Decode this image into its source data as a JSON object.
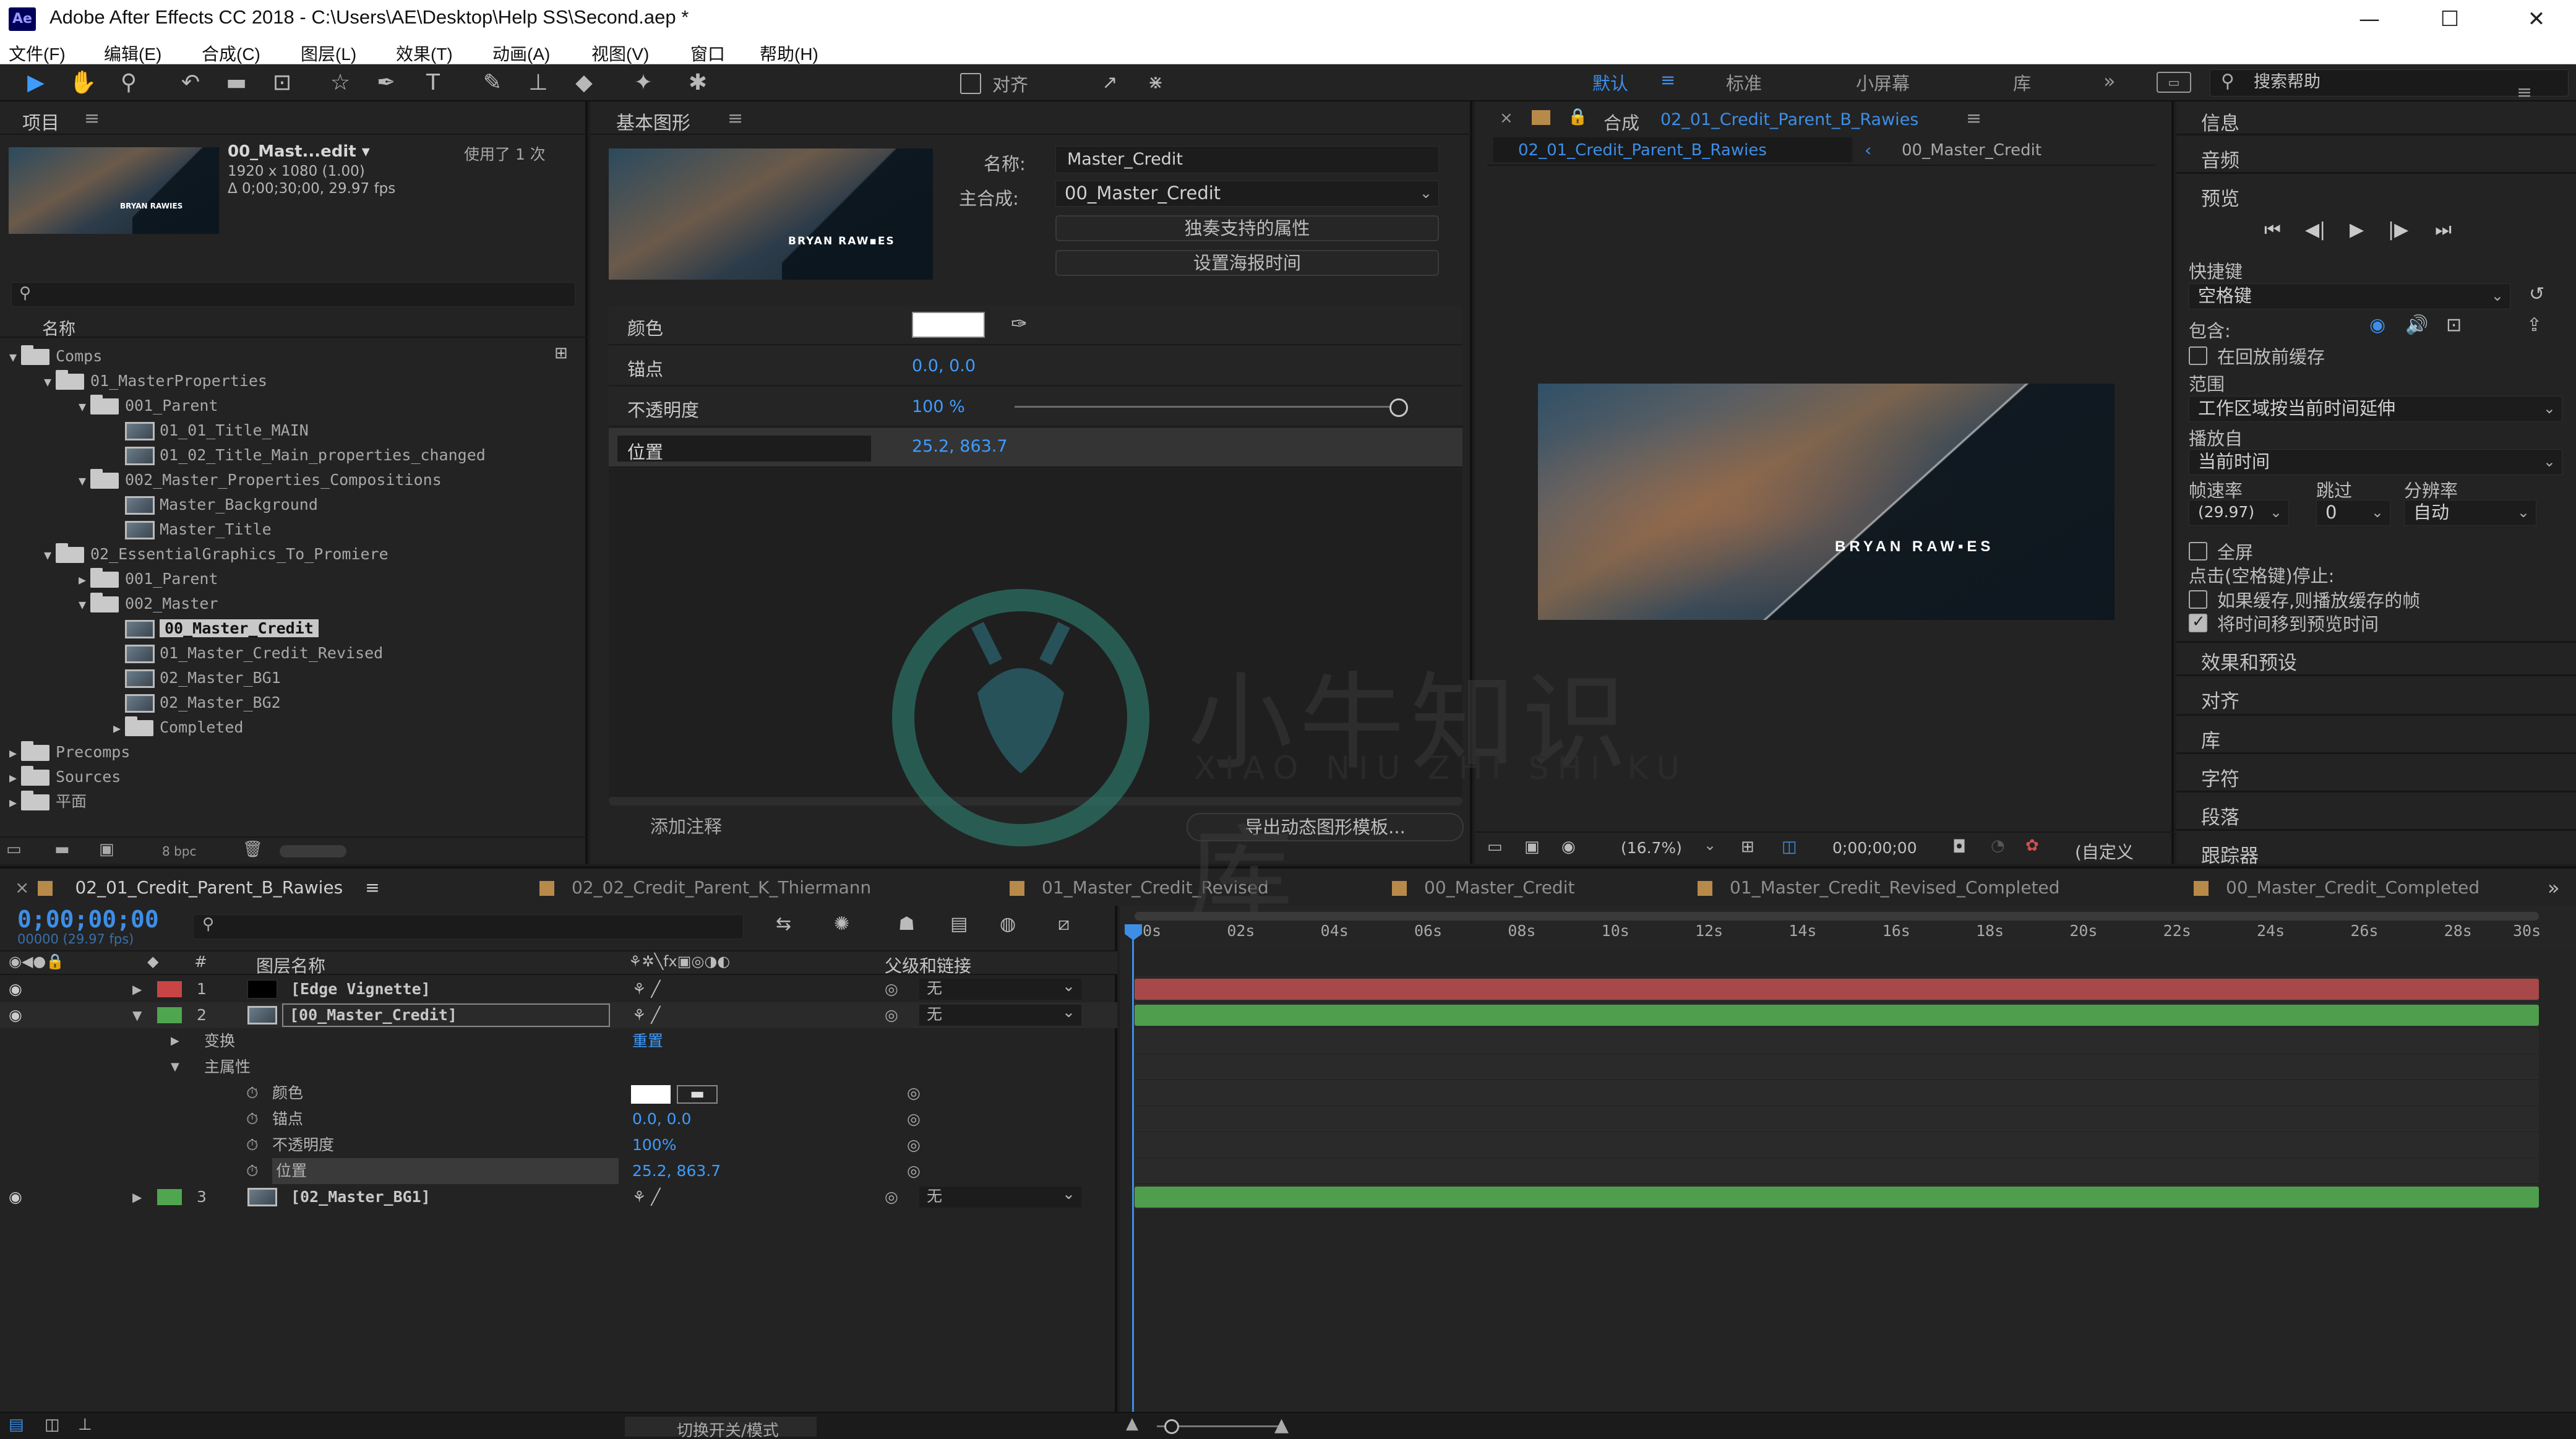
{
  "window": {
    "app_badge": "Ae",
    "title": "Adobe After Effects CC 2018 - C:\\Users\\AE\\Desktop\\Help SS\\Second.aep *",
    "min_glyph": "—",
    "max_glyph": "☐",
    "close_glyph": "✕"
  },
  "menu": [
    "文件(F)",
    "编辑(E)",
    "合成(C)",
    "图层(L)",
    "效果(T)",
    "动画(A)",
    "视图(V)",
    "窗口",
    "帮助(H)"
  ],
  "toolbar": {
    "align_label": "对齐",
    "workspaces": [
      "默认",
      "标准",
      "小屏幕",
      "库"
    ],
    "more": "»",
    "search_placeholder": "搜索帮助"
  },
  "project": {
    "title": "项目",
    "selected_name": "00_Mast...edit ▾",
    "used_count": "使用了 1 次",
    "resolution": "1920 x 1080 (1.00)",
    "duration": "Δ 0;00;30;00, 29.97 fps",
    "col_name": "名称",
    "bpc": "8 bpc",
    "tree": [
      {
        "label": "Comps",
        "depth": 0,
        "type": "folder",
        "open": true
      },
      {
        "label": "01_MasterProperties",
        "depth": 1,
        "type": "folder",
        "open": true
      },
      {
        "label": "001_Parent",
        "depth": 2,
        "type": "folder",
        "open": true
      },
      {
        "label": "01_01_Title_MAIN",
        "depth": 3,
        "type": "comp"
      },
      {
        "label": "01_02_Title_Main_properties_changed",
        "depth": 3,
        "type": "comp"
      },
      {
        "label": "002_Master_Properties_Compositions",
        "depth": 2,
        "type": "folder",
        "open": true
      },
      {
        "label": "Master_Background",
        "depth": 3,
        "type": "comp"
      },
      {
        "label": "Master_Title",
        "depth": 3,
        "type": "comp"
      },
      {
        "label": "02_EssentialGraphics_To_Promiere",
        "depth": 1,
        "type": "folder",
        "open": true
      },
      {
        "label": "001_Parent",
        "depth": 2,
        "type": "folder",
        "open": false
      },
      {
        "label": "002_Master",
        "depth": 2,
        "type": "folder",
        "open": true
      },
      {
        "label": "00_Master_Credit",
        "depth": 3,
        "type": "comp",
        "selected": true
      },
      {
        "label": "01_Master_Credit_Revised",
        "depth": 3,
        "type": "comp"
      },
      {
        "label": "02_Master_BG1",
        "depth": 3,
        "type": "comp"
      },
      {
        "label": "02_Master_BG2",
        "depth": 3,
        "type": "comp"
      },
      {
        "label": "Completed",
        "depth": 3,
        "type": "folder",
        "open": false
      },
      {
        "label": "Precomps",
        "depth": 0,
        "type": "folder",
        "open": false
      },
      {
        "label": "Sources",
        "depth": 0,
        "type": "folder",
        "open": false
      },
      {
        "label": "平面",
        "depth": 0,
        "type": "folder",
        "open": false
      }
    ]
  },
  "eg": {
    "title": "基本图形",
    "name_label": "名称:",
    "name_value": "Master_Credit",
    "master_label": "主合成:",
    "master_value": "00_Master_Credit",
    "solo_btn": "独奏支持的属性",
    "poster_btn": "设置海报时间",
    "props": [
      {
        "label": "颜色",
        "value": ""
      },
      {
        "label": "锚点",
        "value": "0.0, 0.0"
      },
      {
        "label": "不透明度",
        "value": "100 %"
      },
      {
        "label": "位置",
        "value": "25.2, 863.7"
      }
    ],
    "add_comment": "添加注释",
    "export_btn": "导出动态图形模板..."
  },
  "comp": {
    "close": "×",
    "title_prefix": "合成",
    "title_name": "02_01_Credit_Parent_B_Rawies",
    "crumb_active": "02_01_Credit_Parent_B_Rawies",
    "crumb_sep": "‹",
    "crumb_next": "00_Master_Credit",
    "overlay_text": "BRYAN RAW▪ES",
    "zoom": "(16.7%)",
    "timecode": "0;00;00;00",
    "res": "(自定义"
  },
  "info": {
    "info": "信息",
    "audio": "音频",
    "preview": "预览",
    "shortcut_label": "快捷键",
    "shortcut_value": "空格键",
    "include_label": "包含:",
    "cache_before": "在回放前缓存",
    "range_label": "范围",
    "range_value": "工作区域按当前时间延伸",
    "play_from_label": "播放自",
    "play_from_value": "当前时间",
    "fps_label": "帧速率",
    "skip_label": "跳过",
    "res_label": "分辨率",
    "fps_value": "(29.97)",
    "skip_value": "0",
    "res_value": "自动",
    "fullscreen": "全屏",
    "stop_label": "点击(空格键)停止:",
    "stop_opt1": "如果缓存,则播放缓存的帧",
    "stop_opt2": "将时间移到预览时间",
    "effects": "效果和预设",
    "align": "对齐",
    "library": "库",
    "character": "字符",
    "paragraph": "段落",
    "tracker": "跟踪器"
  },
  "timeline": {
    "tabs": [
      {
        "label": "02_01_Credit_Parent_B_Rawies",
        "active": true
      },
      {
        "label": "02_02_Credit_Parent_K_Thiermann"
      },
      {
        "label": "01_Master_Credit_Revised"
      },
      {
        "label": "00_Master_Credit"
      },
      {
        "label": "01_Master_Credit_Revised_Completed"
      },
      {
        "label": "00_Master_Credit_Completed"
      }
    ],
    "timecode": "0;00;00;00",
    "frames": "00000 (29.97 fps)",
    "col_hash": "#",
    "col_layer_name": "图层名称",
    "col_parent": "父级和链接",
    "layers": [
      {
        "num": "1",
        "name": "[Edge Vignette]",
        "color": "#c94545",
        "parent": "无"
      },
      {
        "num": "2",
        "name": "[00_Master_Credit]",
        "color": "#4fa64f",
        "parent": "无"
      },
      {
        "num": "3",
        "name": "[02_Master_BG1]",
        "color": "#4fa64f",
        "parent": "无"
      }
    ],
    "transform_label": "变换",
    "reset_label": "重置",
    "master_props_label": "主属性",
    "master_props": [
      {
        "label": "颜色",
        "value": ""
      },
      {
        "label": "锚点",
        "value": "0.0, 0.0"
      },
      {
        "label": "不透明度",
        "value": "100%"
      },
      {
        "label": "位置",
        "value": "25.2, 863.7"
      }
    ],
    "ruler": [
      "00s",
      "02s",
      "04s",
      "06s",
      "08s",
      "10s",
      "12s",
      "14s",
      "16s",
      "18s",
      "20s",
      "22s",
      "24s",
      "26s",
      "28s",
      "30s"
    ],
    "footer_toggle": "切换开关/模式"
  },
  "watermark": {
    "cn": "小牛知识库",
    "en": "XIAO NIU ZHI SHI KU"
  }
}
